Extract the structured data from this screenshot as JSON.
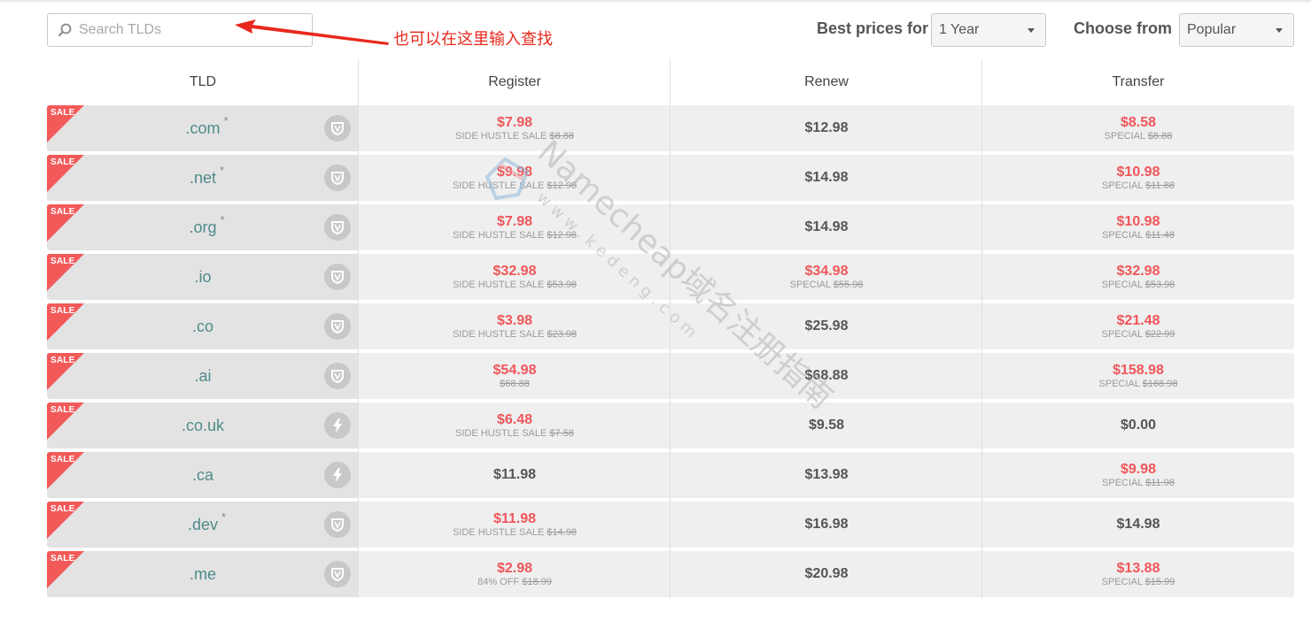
{
  "search": {
    "placeholder": "Search TLDs",
    "value": ""
  },
  "annotation": "也可以在这里输入查找",
  "best_prices": {
    "label": "Best prices for",
    "selected": "1 Year"
  },
  "choose_from": {
    "label": "Choose from",
    "selected": "Popular"
  },
  "columns": [
    "TLD",
    "Register",
    "Renew",
    "Transfer"
  ],
  "sale_badge": "SALE",
  "watermark": {
    "line1": "Namecheap域名注册指南",
    "line2": "w w w . k e d e n g . c o m"
  },
  "colors": {
    "sale": "#f25a5a",
    "price_sale": "#f0565a",
    "tld": "#4f8b89"
  },
  "rows": [
    {
      "tld": ".com",
      "star": "*",
      "badge_icon": "shield-icon",
      "register": {
        "price": "$7.98",
        "sale": true,
        "note": "SIDE HUSTLE SALE",
        "old": "$8.88"
      },
      "renew": {
        "price": "$12.98",
        "sale": false,
        "note": "",
        "old": ""
      },
      "transfer": {
        "price": "$8.58",
        "sale": true,
        "note": "SPECIAL",
        "old": "$8.88"
      }
    },
    {
      "tld": ".net",
      "star": "*",
      "badge_icon": "shield-icon",
      "register": {
        "price": "$9.98",
        "sale": true,
        "note": "SIDE HUSTLE SALE",
        "old": "$12.98"
      },
      "renew": {
        "price": "$14.98",
        "sale": false,
        "note": "",
        "old": ""
      },
      "transfer": {
        "price": "$10.98",
        "sale": true,
        "note": "SPECIAL",
        "old": "$11.88"
      }
    },
    {
      "tld": ".org",
      "star": "*",
      "badge_icon": "shield-icon",
      "register": {
        "price": "$7.98",
        "sale": true,
        "note": "SIDE HUSTLE SALE",
        "old": "$12.98"
      },
      "renew": {
        "price": "$14.98",
        "sale": false,
        "note": "",
        "old": ""
      },
      "transfer": {
        "price": "$10.98",
        "sale": true,
        "note": "SPECIAL",
        "old": "$11.48"
      }
    },
    {
      "tld": ".io",
      "star": "",
      "badge_icon": "shield-icon",
      "register": {
        "price": "$32.98",
        "sale": true,
        "note": "SIDE HUSTLE SALE",
        "old": "$53.98"
      },
      "renew": {
        "price": "$34.98",
        "sale": true,
        "note": "SPECIAL",
        "old": "$55.98"
      },
      "transfer": {
        "price": "$32.98",
        "sale": true,
        "note": "SPECIAL",
        "old": "$53.98"
      }
    },
    {
      "tld": ".co",
      "star": "",
      "badge_icon": "shield-icon",
      "register": {
        "price": "$3.98",
        "sale": true,
        "note": "SIDE HUSTLE SALE",
        "old": "$23.98"
      },
      "renew": {
        "price": "$25.98",
        "sale": false,
        "note": "",
        "old": ""
      },
      "transfer": {
        "price": "$21.48",
        "sale": true,
        "note": "SPECIAL",
        "old": "$22.99"
      }
    },
    {
      "tld": ".ai",
      "star": "",
      "badge_icon": "shield-icon",
      "register": {
        "price": "$54.98",
        "sale": true,
        "note": "",
        "old": "$68.88"
      },
      "renew": {
        "price": "$68.88",
        "sale": false,
        "note": "",
        "old": ""
      },
      "transfer": {
        "price": "$158.98",
        "sale": true,
        "note": "SPECIAL",
        "old": "$168.98"
      }
    },
    {
      "tld": ".co.uk",
      "star": "",
      "badge_icon": "lightning-icon",
      "register": {
        "price": "$6.48",
        "sale": true,
        "note": "SIDE HUSTLE SALE",
        "old": "$7.58"
      },
      "renew": {
        "price": "$9.58",
        "sale": false,
        "note": "",
        "old": ""
      },
      "transfer": {
        "price": "$0.00",
        "sale": false,
        "note": "",
        "old": ""
      }
    },
    {
      "tld": ".ca",
      "star": "",
      "badge_icon": "lightning-icon",
      "register": {
        "price": "$11.98",
        "sale": false,
        "note": "",
        "old": ""
      },
      "renew": {
        "price": "$13.98",
        "sale": false,
        "note": "",
        "old": ""
      },
      "transfer": {
        "price": "$9.98",
        "sale": true,
        "note": "SPECIAL",
        "old": "$11.98"
      }
    },
    {
      "tld": ".dev",
      "star": "*",
      "badge_icon": "shield-icon",
      "register": {
        "price": "$11.98",
        "sale": true,
        "note": "SIDE HUSTLE SALE",
        "old": "$14.98"
      },
      "renew": {
        "price": "$16.98",
        "sale": false,
        "note": "",
        "old": ""
      },
      "transfer": {
        "price": "$14.98",
        "sale": false,
        "note": "",
        "old": ""
      }
    },
    {
      "tld": ".me",
      "star": "",
      "badge_icon": "shield-icon",
      "register": {
        "price": "$2.98",
        "sale": true,
        "note": "84% OFF",
        "old": "$18.99"
      },
      "renew": {
        "price": "$20.98",
        "sale": false,
        "note": "",
        "old": ""
      },
      "transfer": {
        "price": "$13.88",
        "sale": true,
        "note": "SPECIAL",
        "old": "$15.99"
      }
    }
  ]
}
